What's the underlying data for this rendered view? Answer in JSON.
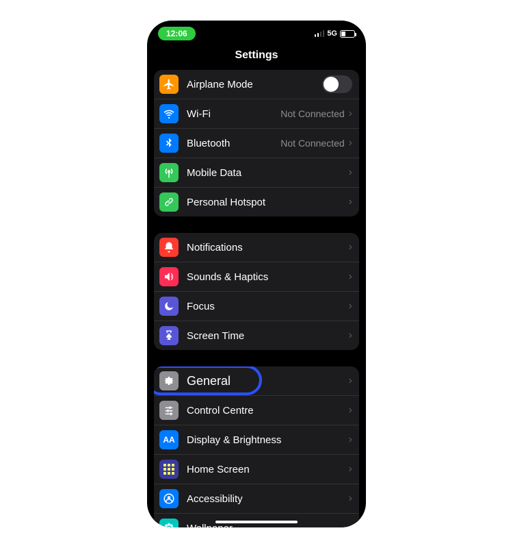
{
  "statusbar": {
    "time": "12:06",
    "network": "5G"
  },
  "header": {
    "title": "Settings"
  },
  "groups": [
    {
      "rows": [
        {
          "icon": "airplane",
          "bg": "#ff9500",
          "label": "Airplane Mode",
          "toggle": true
        },
        {
          "icon": "wifi",
          "bg": "#007aff",
          "label": "Wi-Fi",
          "value": "Not Connected",
          "chevron": true
        },
        {
          "icon": "bluetooth",
          "bg": "#007aff",
          "label": "Bluetooth",
          "value": "Not Connected",
          "chevron": true
        },
        {
          "icon": "antenna",
          "bg": "#34c759",
          "label": "Mobile Data",
          "chevron": true
        },
        {
          "icon": "link",
          "bg": "#34c759",
          "label": "Personal Hotspot",
          "chevron": true
        }
      ]
    },
    {
      "rows": [
        {
          "icon": "bell",
          "bg": "#ff3b30",
          "label": "Notifications",
          "chevron": true
        },
        {
          "icon": "speaker",
          "bg": "#ff2d55",
          "label": "Sounds & Haptics",
          "chevron": true
        },
        {
          "icon": "moon",
          "bg": "#5856d6",
          "label": "Focus",
          "chevron": true
        },
        {
          "icon": "hourglass",
          "bg": "#5856d6",
          "label": "Screen Time",
          "chevron": true
        }
      ]
    },
    {
      "rows": [
        {
          "icon": "gear",
          "bg": "#8e8e93",
          "label": "General",
          "chevron": true,
          "highlight": true
        },
        {
          "icon": "sliders",
          "bg": "#8e8e93",
          "label": "Control Centre",
          "chevron": true
        },
        {
          "icon": "aa",
          "bg": "#007aff",
          "label": "Display & Brightness",
          "chevron": true
        },
        {
          "icon": "grid",
          "bg": "#3a3a9f",
          "label": "Home Screen",
          "chevron": true
        },
        {
          "icon": "person",
          "bg": "#007aff",
          "label": "Accessibility",
          "chevron": true
        },
        {
          "icon": "flower",
          "bg": "#00c7be",
          "label": "Wallpaper",
          "chevron": true
        }
      ]
    }
  ]
}
